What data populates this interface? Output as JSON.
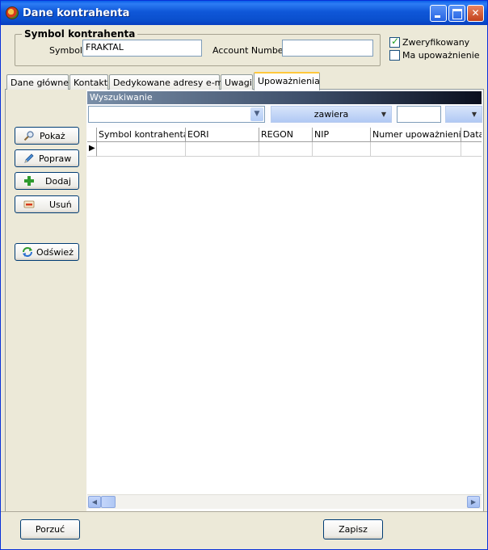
{
  "window": {
    "title": "Dane kontrahenta"
  },
  "symbol_group": {
    "legend": "Symbol kontrahenta",
    "symbol_label": "Symbol:",
    "symbol_value": "FRAKTAL",
    "account_label": "Account Number:",
    "account_value": ""
  },
  "checks": {
    "verified_label": "Zweryfikowany",
    "verified_checked": true,
    "authorized_label": "Ma upoważnienie",
    "authorized_checked": false
  },
  "tabs": [
    {
      "label": "Dane główne",
      "active": false
    },
    {
      "label": "Kontakt",
      "active": false
    },
    {
      "label": "Dedykowane adresy e-mail",
      "active": false
    },
    {
      "label": "Uwagi",
      "active": false
    },
    {
      "label": "Upoważnienia",
      "active": true
    }
  ],
  "side_buttons": {
    "show": "Pokaż",
    "edit": "Popraw",
    "add": "Dodaj",
    "delete": "Usuń",
    "refresh": "Odśwież"
  },
  "search": {
    "header": "Wyszukiwanie",
    "field_value": "",
    "operator_value": "zawiera",
    "text_value": ""
  },
  "grid": {
    "columns": [
      "Symbol kontrahenta",
      "EORI",
      "REGON",
      "NIP",
      "Numer upoważnienia",
      "Data"
    ],
    "rows": [
      [
        "",
        "",
        "",
        "",
        "",
        ""
      ]
    ]
  },
  "footer": {
    "cancel": "Porzuć",
    "save": "Zapisz"
  }
}
